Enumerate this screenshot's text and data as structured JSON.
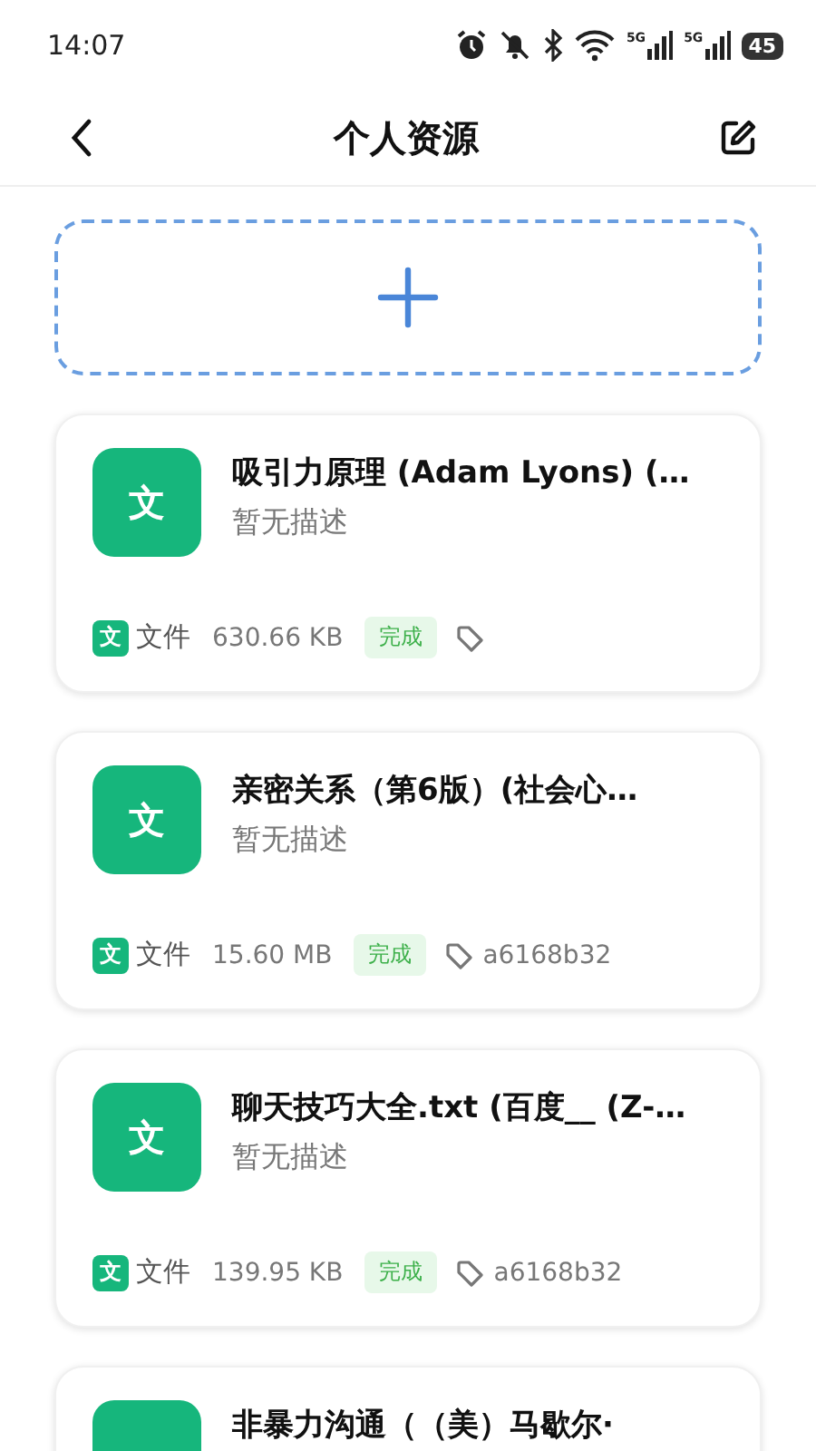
{
  "status_bar": {
    "time": "14:07",
    "signals": [
      {
        "label": "5G"
      },
      {
        "label": "5G"
      }
    ],
    "battery": "45"
  },
  "header": {
    "title": "个人资源"
  },
  "resources": [
    {
      "icon_glyph": "文",
      "title": "吸引力原理 (Adam Lyons) (…",
      "description": "暂无描述",
      "type_glyph": "文",
      "type_label": "文件",
      "size": "630.66 KB",
      "status": "完成"
    },
    {
      "icon_glyph": "文",
      "title": "亲密关系（第6版）(社会心…",
      "description": "暂无描述",
      "type_glyph": "文",
      "type_label": "文件",
      "size": "15.60 MB",
      "status": "完成",
      "tag": "a6168b32"
    },
    {
      "icon_glyph": "文",
      "title": "聊天技巧大全.txt (百度__ (Z-…",
      "description": "暂无描述",
      "type_glyph": "文",
      "type_label": "文件",
      "size": "139.95 KB",
      "status": "完成",
      "tag": "a6168b32"
    },
    {
      "title": "非暴力沟通（（美）马歇尔·"
    }
  ]
}
